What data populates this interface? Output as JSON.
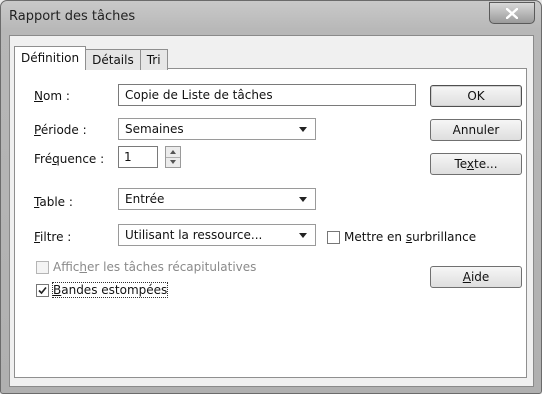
{
  "window": {
    "title": "Rapport des tâches"
  },
  "tabs": [
    {
      "label": "Définition",
      "active": true
    },
    {
      "label": "Détails",
      "active": false
    },
    {
      "label": "Tri",
      "active": false
    }
  ],
  "form": {
    "nom": {
      "label_pre": "",
      "label_u": "N",
      "label_post": "om :",
      "value": "Copie de Liste de tâches"
    },
    "periode": {
      "label_pre": "",
      "label_u": "P",
      "label_post": "ériode :",
      "value": "Semaines"
    },
    "frequence": {
      "label_pre": "Fré",
      "label_u": "q",
      "label_post": "uence :",
      "value": "1"
    },
    "table": {
      "label_pre": "",
      "label_u": "T",
      "label_post": "able :",
      "value": "Entrée"
    },
    "filtre": {
      "label_pre": "",
      "label_u": "F",
      "label_post": "iltre :",
      "value": "Utilisant la ressource..."
    },
    "highlight": {
      "label_pre": "Mettre en ",
      "label_u": "s",
      "label_post": "urbrillance",
      "checked": false
    },
    "summary_tasks": {
      "label_pre": "Affic",
      "label_u": "h",
      "label_post": "er les tâches récapitulatives",
      "checked": false,
      "enabled": false
    },
    "gray_bands": {
      "label_pre": "",
      "label_u": "B",
      "label_post": "andes estompées",
      "checked": true
    }
  },
  "buttons": {
    "ok": {
      "label": "OK"
    },
    "cancel": {
      "label": "Annuler"
    },
    "text": {
      "label_pre": "Te",
      "label_u": "x",
      "label_post": "te..."
    },
    "help": {
      "label_pre": "",
      "label_u": "A",
      "label_post": "ide"
    }
  },
  "icons": {
    "close": "close-icon",
    "dropdown": "chevron-down-icon",
    "spin_up": "spin-up-icon",
    "spin_down": "spin-down-icon",
    "check": "checkmark-icon"
  }
}
